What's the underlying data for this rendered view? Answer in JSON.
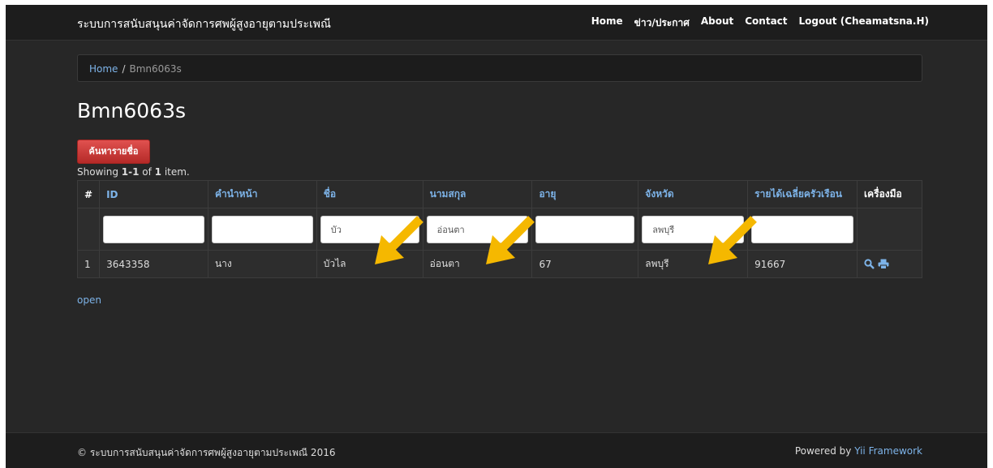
{
  "navbar": {
    "brand": "ระบบการสนับสนุนค่าจัดการศพผู้สูงอายุตามประเพณี",
    "links": [
      "Home",
      "ข่าว/ประกาศ",
      "About",
      "Contact",
      "Logout (Cheamatsna.H)"
    ]
  },
  "breadcrumb": {
    "home": "Home",
    "separator": "/",
    "current": "Bmn6063s"
  },
  "page_title": "Bmn6063s",
  "search_button": "ค้นหารายชื่อ",
  "summary": {
    "prefix": "Showing ",
    "range": "1-1",
    "middle": " of ",
    "total": "1",
    "suffix": " item."
  },
  "grid": {
    "headers": [
      "#",
      "ID",
      "คำนำหน้า",
      "ชื่อ",
      "นามสกุล",
      "อายุ",
      "จังหวัด",
      "รายได้เฉลี่ยครัวเรือน",
      "เครื่องมือ"
    ],
    "filters": [
      "",
      "",
      "บัว",
      "อ่อนตา",
      "",
      "ลพบุรี",
      ""
    ],
    "rows": [
      [
        "1",
        "3643358",
        "นาง",
        "บัวไล",
        "อ่อนตา",
        "67",
        "ลพบุรี",
        "91667"
      ]
    ],
    "row_tools": [
      "search-icon",
      "print-icon"
    ]
  },
  "open_link": "open",
  "footer": {
    "left": "© ระบบการสนับสนุนค่าจัดการศพผู้สูงอายุตามประเพณี 2016",
    "right_prefix": "Powered by ",
    "right_link": "Yii Framework"
  },
  "colors": {
    "arrow": "#f5b800",
    "link": "#7db3e8",
    "button": "#c9302c",
    "background": "#272727"
  }
}
